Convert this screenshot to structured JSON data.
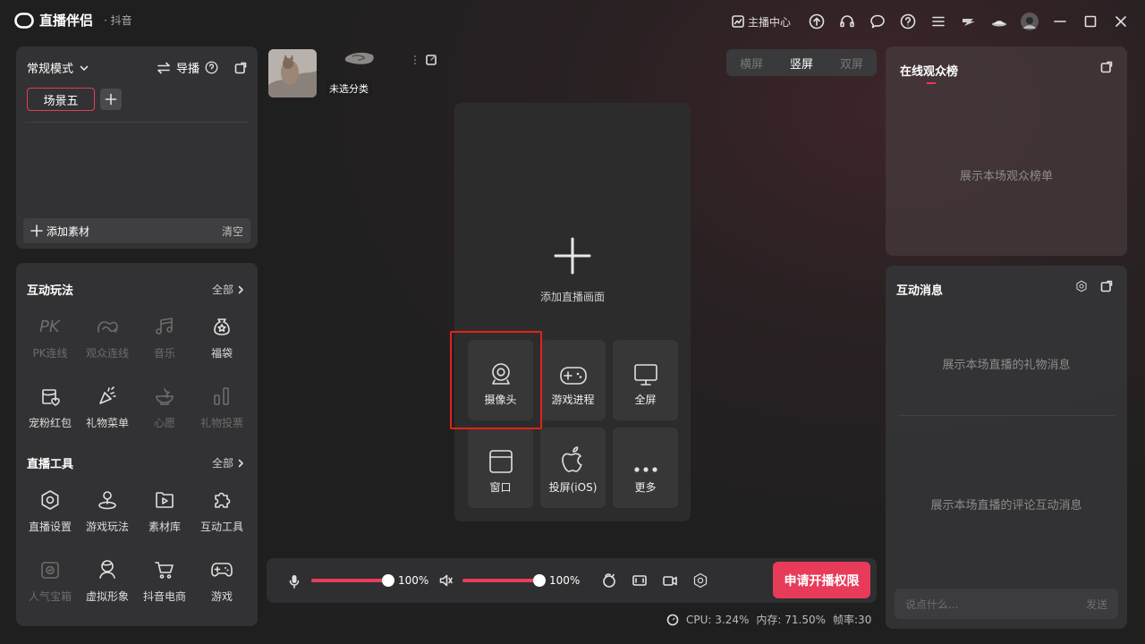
{
  "app": {
    "name": "直播伴侣",
    "platform": "抖音"
  },
  "titlebar": {
    "anchor_center": "主播中心"
  },
  "scene": {
    "mode": "常规模式",
    "guide": "导播",
    "active_scene": "场景五",
    "add_material": "添加素材",
    "clear": "清空"
  },
  "interactive": {
    "title": "互动玩法",
    "all": "全部",
    "items": [
      {
        "label": "PK连线",
        "icon": "pk-icon"
      },
      {
        "label": "观众连线",
        "icon": "audience-link-icon"
      },
      {
        "label": "音乐",
        "icon": "music-icon"
      },
      {
        "label": "福袋",
        "icon": "lucky-bag-icon"
      },
      {
        "label": "宠粉红包",
        "icon": "red-packet-icon"
      },
      {
        "label": "礼物菜单",
        "icon": "gift-menu-icon"
      },
      {
        "label": "心愿",
        "icon": "wish-icon"
      },
      {
        "label": "礼物投票",
        "icon": "gift-vote-icon"
      }
    ]
  },
  "tools": {
    "title": "直播工具",
    "all": "全部",
    "items": [
      {
        "label": "直播设置",
        "icon": "settings-icon"
      },
      {
        "label": "游戏玩法",
        "icon": "joystick-icon"
      },
      {
        "label": "素材库",
        "icon": "library-icon"
      },
      {
        "label": "互动工具",
        "icon": "puzzle-icon"
      },
      {
        "label": "人气宝箱",
        "icon": "treasure-box-icon"
      },
      {
        "label": "虚拟形象",
        "icon": "avatar-icon"
      },
      {
        "label": "抖音电商",
        "icon": "cart-icon"
      },
      {
        "label": "游戏",
        "icon": "gamepad-icon"
      }
    ]
  },
  "thumbs": {
    "uncategorized": "未选分类"
  },
  "orientation": {
    "landscape": "横屏",
    "portrait": "竖屏",
    "dual": "双屏",
    "selected": "竖屏"
  },
  "stage": {
    "add_label": "添加直播画面",
    "sources": [
      {
        "label": "摄像头",
        "icon": "camera-icon"
      },
      {
        "label": "游戏进程",
        "icon": "gamepad-icon"
      },
      {
        "label": "全屏",
        "icon": "monitor-icon"
      },
      {
        "label": "窗口",
        "icon": "window-icon"
      },
      {
        "label": "投屏(iOS)",
        "icon": "apple-icon"
      },
      {
        "label": "更多",
        "icon": "more-icon"
      }
    ]
  },
  "controls": {
    "mic_volume": "100%",
    "speaker_volume": "100%",
    "mic_level": 1.0,
    "speaker_level": 1.0,
    "go_live": "申请开播权限"
  },
  "status": {
    "cpu": "CPU: 3.24%",
    "memory": "内存: 71.50%",
    "fps": "帧率:30"
  },
  "right": {
    "rank_title": "在线观众榜",
    "rank_empty": "展示本场观众榜单",
    "msg_title": "互动消息",
    "gift_empty": "展示本场直播的礼物消息",
    "comment_empty": "展示本场直播的评论互动消息",
    "chat_placeholder": "说点什么...",
    "send": "发送"
  }
}
